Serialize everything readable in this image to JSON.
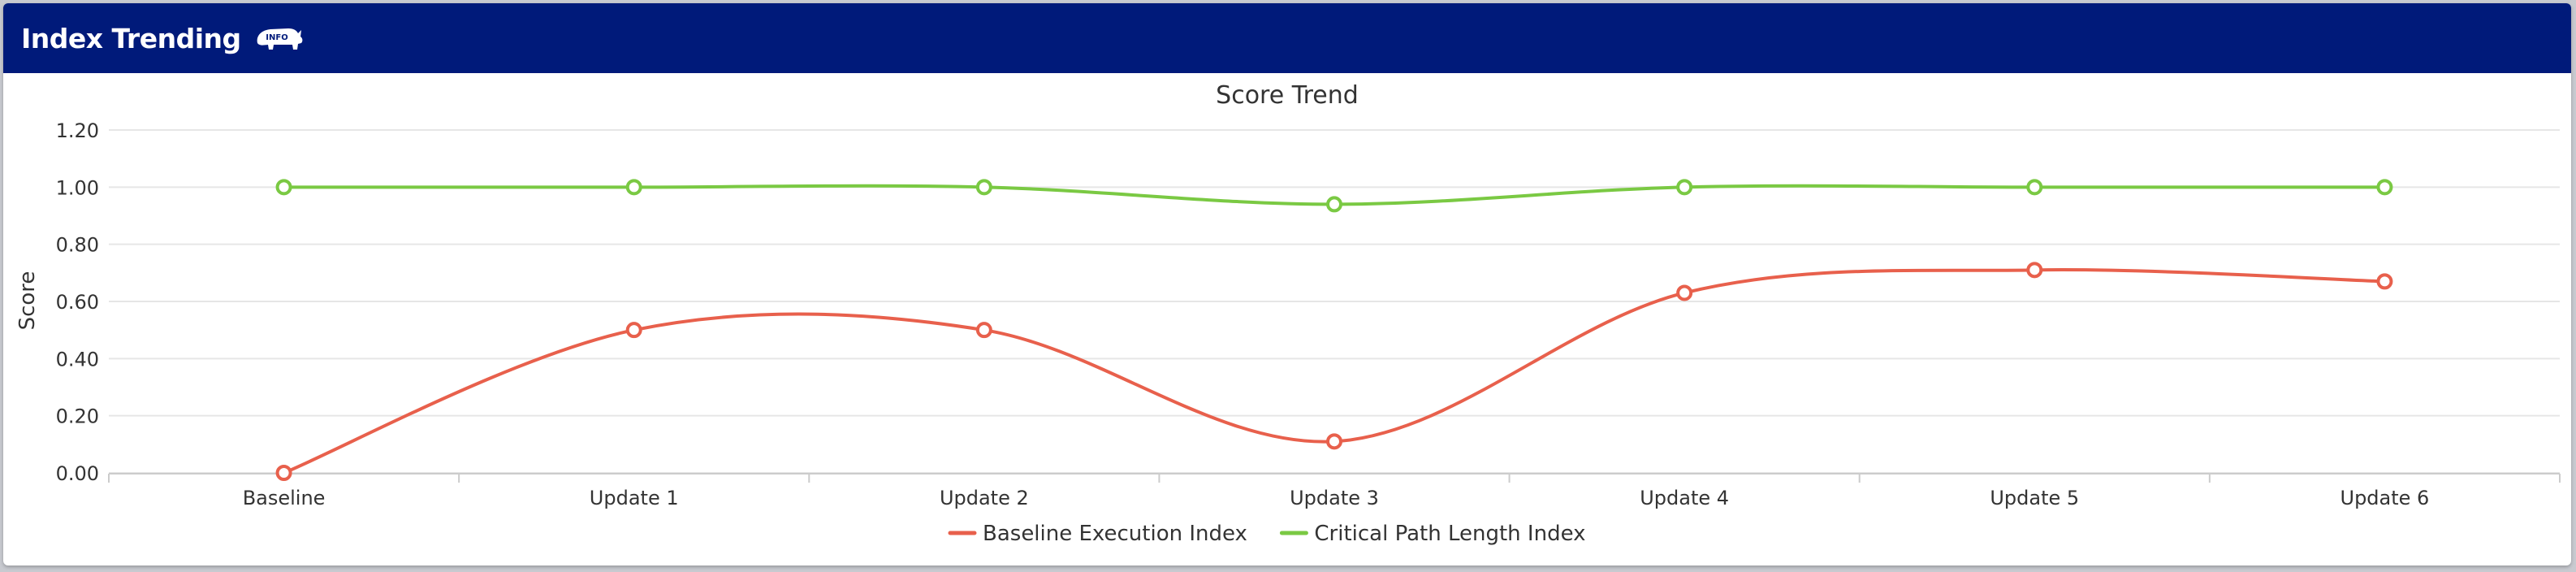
{
  "header": {
    "title": "Index Trending",
    "info_icon_text": "INFO",
    "info_icon": "rhino-info-icon"
  },
  "chart_data": {
    "type": "line",
    "smooth": true,
    "title": "Score Trend",
    "xlabel": "",
    "ylabel": "Score",
    "categories": [
      "Baseline",
      "Update 1",
      "Update 2",
      "Update 3",
      "Update 4",
      "Update 5",
      "Update 6"
    ],
    "ylim": [
      0,
      1.2
    ],
    "yticks": [
      "0.00",
      "0.20",
      "0.40",
      "0.60",
      "0.80",
      "1.00",
      "1.20"
    ],
    "grid": true,
    "legend_position": "bottom-center",
    "series": [
      {
        "name": "Baseline Execution Index",
        "color": "#e8604c",
        "values": [
          0.0,
          0.5,
          0.5,
          0.11,
          0.63,
          0.71,
          0.67
        ]
      },
      {
        "name": "Critical Path Length Index",
        "color": "#7ac943",
        "values": [
          1.0,
          1.0,
          1.0,
          0.94,
          1.0,
          1.0,
          1.0
        ]
      }
    ]
  }
}
